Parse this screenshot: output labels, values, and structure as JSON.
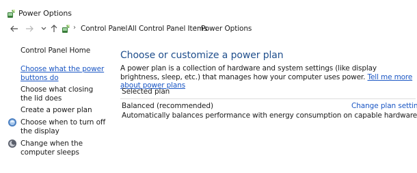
{
  "window": {
    "title": "Power Options"
  },
  "navigation": {
    "back_icon": "back-arrow-icon",
    "forward_icon": "forward-arrow-icon",
    "recent_icon": "chevron-down-icon",
    "up_icon": "up-arrow-icon",
    "breadcrumb": [
      "Control Panel",
      "All Control Panel Items",
      "Power Options"
    ]
  },
  "sidebar": {
    "home": "Control Panel Home",
    "links": [
      {
        "label": "Choose what the power buttons do",
        "active": true
      },
      {
        "label": "Choose what closing the lid does",
        "active": false
      },
      {
        "label": "Create a power plan",
        "active": false
      },
      {
        "label": "Choose when to turn off the display",
        "active": false,
        "icon": "display-icon"
      },
      {
        "label": "Change when the computer sleeps",
        "active": false,
        "icon": "sleep-moon-icon"
      }
    ]
  },
  "main": {
    "heading": "Choose or customize a power plan",
    "description": "A power plan is a collection of hardware and system settings (like display brightness, sleep, etc.) that manages how your computer uses power.",
    "learn_more_link": "Tell me more about power plans",
    "section_label": "Selected plan",
    "plan": {
      "name": "Balanced (recommended)",
      "change_link": "Change plan settings",
      "description": "Automatically balances performance with energy consumption on capable hardware."
    }
  },
  "colors": {
    "link": "#1a56c4",
    "heading": "#1f4e8c"
  }
}
